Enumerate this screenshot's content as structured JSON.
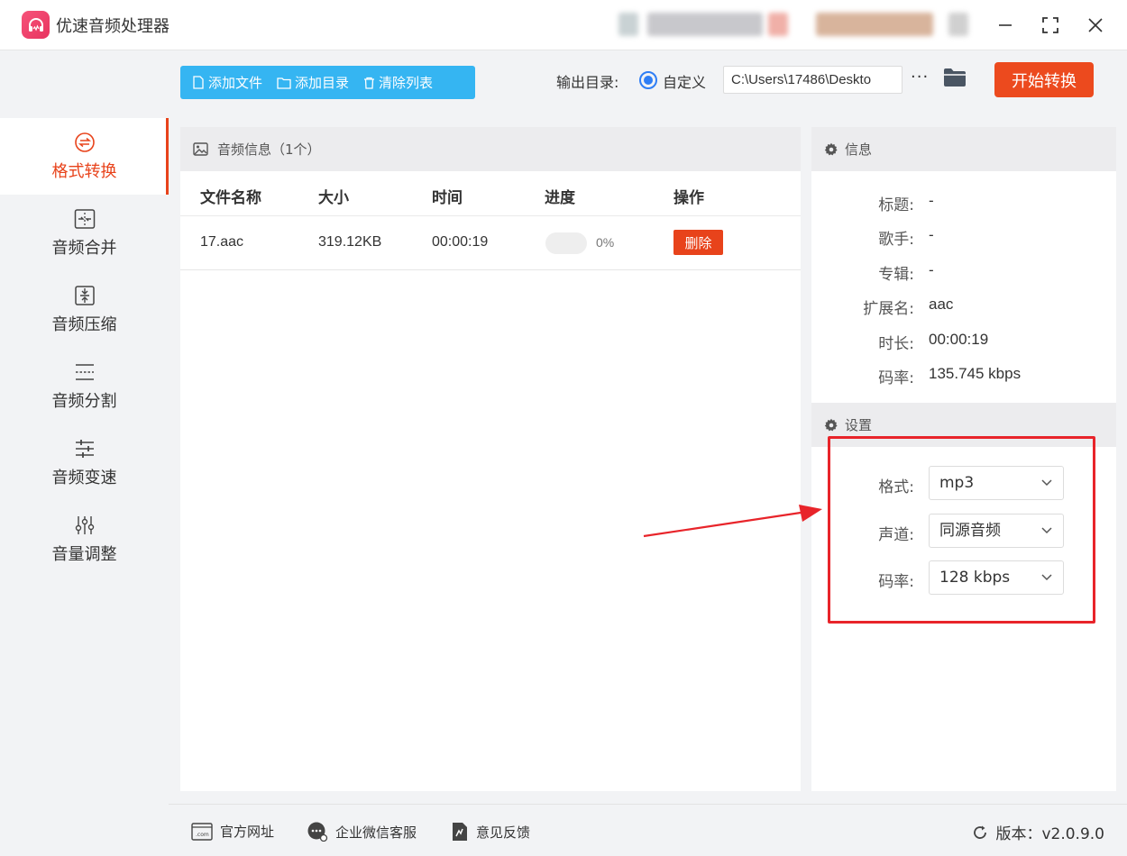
{
  "app": {
    "title": "优速音频处理器"
  },
  "sidebar": {
    "items": [
      {
        "label": "格式转换",
        "icon": "swap-circle-icon",
        "active": true
      },
      {
        "label": "音频合并",
        "icon": "merge-icon",
        "active": false
      },
      {
        "label": "音频压缩",
        "icon": "compress-icon",
        "active": false
      },
      {
        "label": "音频分割",
        "icon": "split-icon",
        "active": false
      },
      {
        "label": "音频变速",
        "icon": "sliders-icon",
        "active": false
      },
      {
        "label": "音量调整",
        "icon": "volume-sliders-icon",
        "active": false
      }
    ]
  },
  "toolbar": {
    "add_file": "添加文件",
    "add_dir": "添加目录",
    "clear_list": "清除列表",
    "output_label": "输出目录:",
    "radio_label": "自定义",
    "output_path": "C:\\Users\\17486\\Deskto",
    "more": "···",
    "start": "开始转换"
  },
  "file_panel": {
    "title": "音频信息（1个）",
    "columns": [
      "文件名称",
      "大小",
      "时间",
      "进度",
      "操作"
    ],
    "rows": [
      {
        "name": "17.aac",
        "size": "319.12KB",
        "time": "00:00:19",
        "progress": 0,
        "progress_text": "0%",
        "action": "删除"
      }
    ]
  },
  "info": {
    "title": "信息",
    "fields": [
      {
        "key": "标题:",
        "value": "-"
      },
      {
        "key": "歌手:",
        "value": "-"
      },
      {
        "key": "专辑:",
        "value": "-"
      },
      {
        "key": "扩展名:",
        "value": "aac"
      },
      {
        "key": "时长:",
        "value": "00:00:19"
      },
      {
        "key": "码率:",
        "value": "135.745 kbps"
      }
    ]
  },
  "settings": {
    "title": "设置",
    "fields": [
      {
        "key": "格式:",
        "value": "mp3"
      },
      {
        "key": "声道:",
        "value": "同源音频"
      },
      {
        "key": "码率:",
        "value": "128 kbps"
      }
    ]
  },
  "footer": {
    "website": "官方网址",
    "wechat": "企业微信客服",
    "feedback": "意见反馈",
    "version": "版本：v2.0.9.0"
  },
  "colors": {
    "accent": "#e8431b",
    "toolbar_blue": "#35b5f2",
    "radio_blue": "#2f7ef5",
    "annotation_red": "#e8242a"
  }
}
